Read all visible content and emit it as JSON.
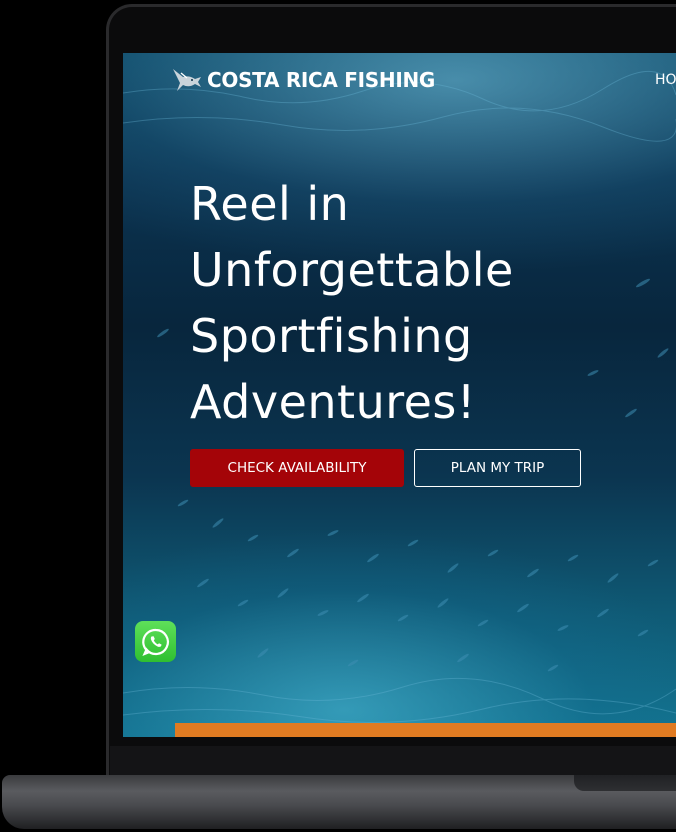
{
  "site": {
    "brand_name": "COSTA RICA FISHING",
    "nav": {
      "home_label": "HO"
    }
  },
  "hero": {
    "title": "Reel in Unforgettable Sportfishing Adventures!",
    "primary_cta": "CHECK AVAILABILITY",
    "secondary_cta": "PLAN MY TRIP"
  },
  "icons": {
    "brand_logo": "marlin-fish-icon",
    "chat": "whatsapp-icon"
  },
  "colors": {
    "primary_button": "#a40408",
    "accent_bar": "#e07b22",
    "whatsapp_green": "#3cc83b"
  }
}
